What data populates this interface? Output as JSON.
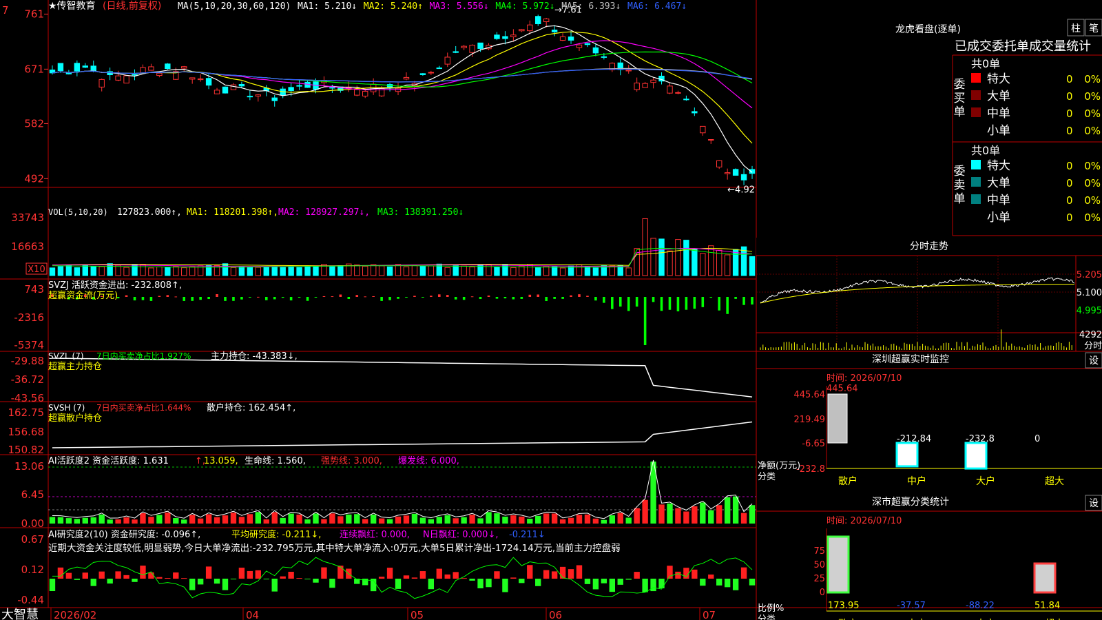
{
  "app": {
    "brand": "大智慧",
    "stock": "传智教育",
    "mode": "(日线,前复权)"
  },
  "kline": {
    "ma_label": "MA(5,10,20,30,60,120)",
    "ma_values": [
      {
        "k": "MA1:",
        "v": "5.210",
        "a": "↓",
        "c": "#ffffff"
      },
      {
        "k": "MA2:",
        "v": "5.240",
        "a": "↑",
        "c": "#ffff00"
      },
      {
        "k": "MA3:",
        "v": "5.556",
        "a": "↓",
        "c": "#ff00ff"
      },
      {
        "k": "MA4:",
        "v": "5.972",
        "a": "↓",
        "c": "#00ff00"
      },
      {
        "k": "MA5:",
        "v": "6.393",
        "a": "↓",
        "c": "#c0c0c0"
      },
      {
        "k": "MA6:",
        "v": "6.467",
        "a": "↓",
        "c": "#3060ff"
      }
    ],
    "y_ticks": [
      "761",
      "671",
      "582",
      "492"
    ],
    "high_label": "7.61",
    "low_label": "←4.92"
  },
  "vol": {
    "head": "VOL(5,10,20)",
    "value": "127823.000",
    "ma1": "118201.398",
    "ma2": "128927.297",
    "ma3": "138391.250",
    "y_ticks": [
      "33743",
      "16663"
    ],
    "x10": "X10"
  },
  "svzj": {
    "head": "SVZJ",
    "label": "活跃资金进出:",
    "value": "-232.808",
    "sub": "超赢资金流(万元)",
    "y_ticks": [
      "743",
      "-2316",
      "-5374"
    ]
  },
  "svzl": {
    "head": "SVZL (7)",
    "ratio": "7日内买卖净占比1.927%",
    "label": "主力持仓:",
    "value": "-43.383",
    "sub": "超赢主力持仓",
    "y_ticks": [
      "-29.88",
      "-36.72",
      "-43.56"
    ]
  },
  "svsh": {
    "head": "SVSH (7)",
    "ratio": "7日内买卖净占比1.644%",
    "label": "散户持仓:",
    "value": "162.454",
    "sub": "超赢散户持仓",
    "y_ticks": [
      "162.75",
      "156.68",
      "150.82"
    ]
  },
  "ai1": {
    "head": "AI活跃度2",
    "a": "资金活跃度: 1.631",
    "b": "13.059,",
    "c": "生命线: 1.560,",
    "d": "强势线: 3.000,",
    "e": "爆发线: 6.000,",
    "y_ticks": [
      "13.06",
      "6.45",
      "0.00"
    ]
  },
  "ai2": {
    "head": "AI研究度2(10)",
    "a": "资金研究度: -0.096",
    "b": "平均研究度: -0.211",
    "c": "连续飘红: 0.000,",
    "d": "N日飘红: 0.000",
    "e": "-0.211",
    "comment": "近期大资金关注度较低,明显弱势,今日大单净流出:-232.795万元,其中特大单净流入:0万元,大单5日累计净出-1724.14万元,当前主力控盘弱",
    "y_ticks": [
      "0.67",
      "0.12",
      "-0.44"
    ]
  },
  "xaxis": [
    "2026/02",
    "04",
    "05",
    "06",
    "07"
  ],
  "lhb": {
    "title": "龙虎看盘(逐单)",
    "btn1": "柱",
    "btn2": "笔",
    "header": "已成交委托单成交量统计",
    "buy": {
      "label": "委买单",
      "total": "共0单",
      "rows": [
        {
          "n": "特大",
          "v": "0",
          "p": "0%",
          "c": "#ff0000"
        },
        {
          "n": "大单",
          "v": "0",
          "p": "0%",
          "c": "#800000"
        },
        {
          "n": "中单",
          "v": "0",
          "p": "0%",
          "c": "#800000"
        },
        {
          "n": "小单",
          "v": "0",
          "p": "0%",
          "c": ""
        }
      ]
    },
    "sell": {
      "label": "委卖单",
      "total": "共0单",
      "rows": [
        {
          "n": "特大",
          "v": "0",
          "p": "0%",
          "c": "#00ffff"
        },
        {
          "n": "大单",
          "v": "0",
          "p": "0%",
          "c": "#008080"
        },
        {
          "n": "中单",
          "v": "0",
          "p": "0%",
          "c": "#008080"
        },
        {
          "n": "小单",
          "v": "0",
          "p": "0%",
          "c": ""
        }
      ]
    }
  },
  "intraday": {
    "title": "分时走势",
    "prices": [
      "5.205",
      "5.100",
      "4.995"
    ],
    "vol": "4292",
    "vol_unit": "分时"
  },
  "monitor": {
    "title": "深圳超赢实时监控",
    "btn": "设",
    "time": "时间: 2026/07/10",
    "y_ticks": [
      "445.64",
      "219.49",
      "-6.65",
      "-232.8"
    ],
    "ylabel": "净额(万元)",
    "xlabel": "分类",
    "cats": [
      "散户",
      "中户",
      "大户",
      "超大"
    ],
    "values": [
      "445.64",
      "-212.84",
      "-232.8",
      "0"
    ]
  },
  "classify": {
    "title": "深市超赢分类统计",
    "btn": "设",
    "time": "时间: 2026/07/10",
    "y_ticks": [
      "75",
      "50",
      "25",
      "0"
    ],
    "ylabel": "比例%",
    "xlabel": "分类",
    "cats": [
      "散户",
      "中户",
      "大户",
      "超大"
    ],
    "values": [
      "173.95",
      "-37.57",
      "-88.22",
      "51.84"
    ]
  }
}
